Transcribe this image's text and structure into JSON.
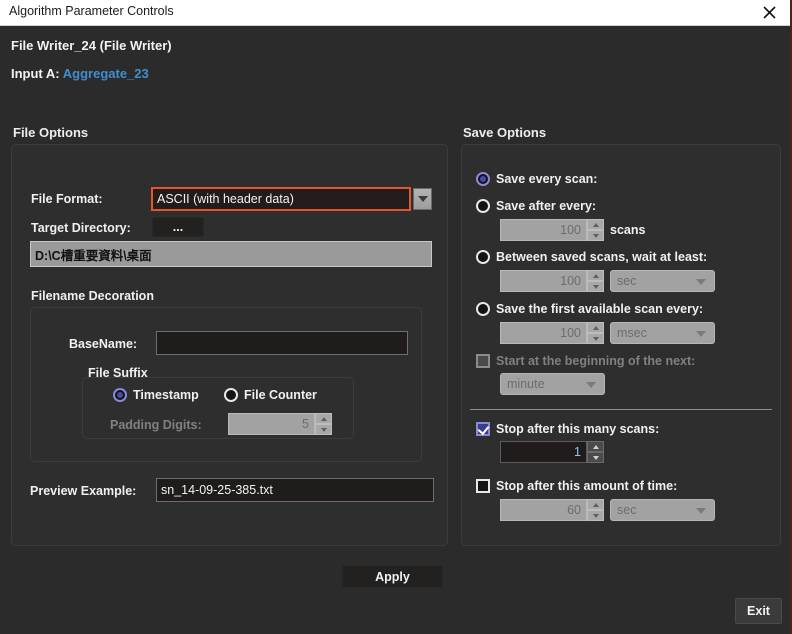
{
  "window": {
    "title": "Algorithm Parameter Controls",
    "close_icon": "close-icon",
    "accent_focus_color": "#e2572a",
    "link_color": "#3f8fd0",
    "selection_color": "#4a4aa8",
    "background_color": "#2b2b2b"
  },
  "header": {
    "node_title": "File Writer_24 (File Writer)",
    "input_label": "Input A:",
    "input_source": "Aggregate_23"
  },
  "file_options": {
    "caption": "File Options",
    "file_format": {
      "label": "File Format:",
      "value": "ASCII (with header data)",
      "arrow_icon": "chevron-down-icon"
    },
    "target_directory": {
      "label": "Target Directory:",
      "browse_label": "...",
      "path": "D:\\C槽重要資料\\桌面"
    },
    "filename_decoration": {
      "caption": "Filename Decoration",
      "basename": {
        "label": "BaseName:",
        "value": ""
      },
      "file_suffix": {
        "caption": "File Suffix",
        "options": [
          {
            "label": "Timestamp",
            "selected": true
          },
          {
            "label": "File Counter",
            "selected": false
          }
        ],
        "padding_digits": {
          "label": "Padding Digits:",
          "value": "5",
          "enabled": false
        }
      }
    },
    "preview_example": {
      "label": "Preview Example:",
      "value": "sn_14-09-25-385.txt"
    }
  },
  "save_options": {
    "caption": "Save Options",
    "modes": [
      {
        "label": "Save every scan:",
        "selected": true
      },
      {
        "label": "Save after every:",
        "selected": false
      },
      {
        "label": "Between saved scans, wait at least:",
        "selected": false
      },
      {
        "label": "Save the first available scan every:",
        "selected": false
      }
    ],
    "save_after_every": {
      "value": "100",
      "unit_label": "scans",
      "enabled": false
    },
    "wait_at_least": {
      "value": "100",
      "unit": "sec",
      "enabled": false
    },
    "first_available": {
      "value": "100",
      "unit": "msec",
      "enabled": false
    },
    "start_at_beginning": {
      "label": "Start at the beginning of the next:",
      "unit": "minute",
      "checked": false,
      "enabled": false
    },
    "stop_after_scans": {
      "label": "Stop after this many scans:",
      "value": "1",
      "checked": true,
      "enabled": true
    },
    "stop_after_time": {
      "label": "Stop after this amount of time:",
      "value": "60",
      "unit": "sec",
      "checked": false,
      "enabled": false
    }
  },
  "footer": {
    "apply_label": "Apply",
    "exit_label": "Exit"
  }
}
